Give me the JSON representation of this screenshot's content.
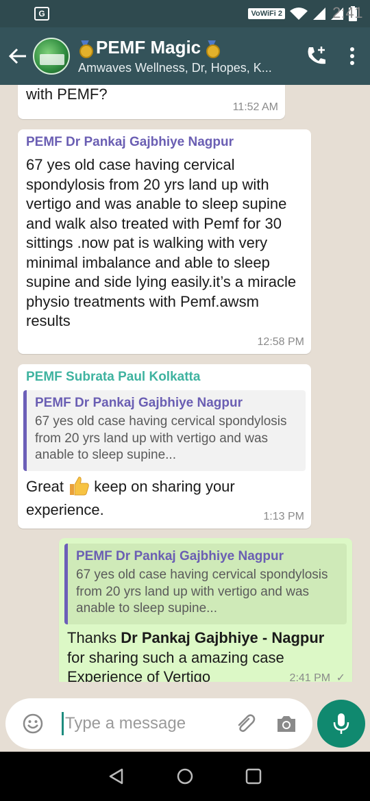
{
  "status": {
    "time": "2:41",
    "vowifi": "VoWiFi 2"
  },
  "header": {
    "title": "PEMF Magic",
    "subtitle": "Amwaves Wellness, Dr, Hopes, K..."
  },
  "messages": [
    {
      "text": "Sir can we treat this patient with PEMF?",
      "time": "11:52 AM"
    },
    {
      "sender": "PEMF Dr Pankaj Gajbhiye Nagpur",
      "sender_color": "#6a5eb3",
      "text": "67 yes old case having cervical spondylosis from 20 yrs land up with vertigo  and was anable to sleep supine and walk also treated with Pemf for 30 sittings .now pat is walking with very minimal imbalance and able to sleep supine and side lying easily.it’s a miracle physio treatments with Pemf.awsm results",
      "time": "12:58 PM"
    },
    {
      "sender": "PEMF Subrata Paul Kolkatta",
      "sender_color": "#3fb3a0",
      "quote_sender": "PEMF Dr Pankaj Gajbhiye Nagpur",
      "quote_text": "67 yes old case having cervical spondylosis from 20 yrs land up with vertigo  and was anable to sleep supine...",
      "text_before": "Great",
      "text_after": " keep on sharing your experience.",
      "emoji": "thumbs-up",
      "time": "1:13 PM"
    },
    {
      "quote_sender": "PEMF Dr Pankaj Gajbhiye Nagpur",
      "quote_text": "67 yes old case having cervical spondylosis from 20 yrs land up with vertigo  and was anable to sleep supine...",
      "text_prefix": "Thanks ",
      "text_bold": "Dr Pankaj Gajbhiye - Nagpur",
      "text_rest": " for sharing such a amazing case Experience of Vertigo",
      "time": "2:41 PM",
      "status": "sent"
    }
  ],
  "input": {
    "placeholder": "Type a message"
  },
  "colors": {
    "header": "#34535a",
    "statusbar": "#2f4a4f",
    "accent": "#10896f",
    "outgoing_bubble": "#dcf8c6",
    "chat_bg": "#e6ded4"
  },
  "icons": [
    "back-arrow-icon",
    "medal-icon",
    "add-call-icon",
    "more-vert-icon",
    "emoji-icon",
    "attach-icon",
    "camera-icon",
    "mic-icon",
    "nav-back-icon",
    "nav-home-icon",
    "nav-recents-icon"
  ]
}
